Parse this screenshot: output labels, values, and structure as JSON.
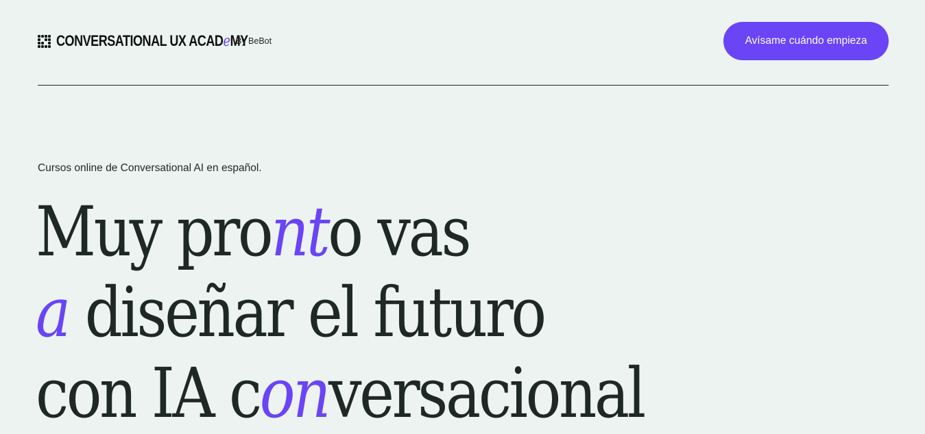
{
  "brand": {
    "name_part1": "CONVERSATIONAL UX ACAD",
    "name_accent": "e",
    "name_part2": "MY",
    "byline": "By BeBot",
    "logo_icon": "dot-grid-logo"
  },
  "header": {
    "cta_label": "Avísame cuándo empieza"
  },
  "hero": {
    "tagline": "Cursos online de Conversational AI en español.",
    "line1": {
      "before": "Muy pro",
      "accent": "nt",
      "after": "o vas"
    },
    "line2": {
      "accent": "a",
      "after": " diseñar el futuro"
    },
    "line3": {
      "before": "con IA c",
      "accent": "on",
      "after": "versacional"
    }
  },
  "colors": {
    "background": "#ecf3f0",
    "accent": "#6a44f5",
    "text": "#1e2824"
  }
}
